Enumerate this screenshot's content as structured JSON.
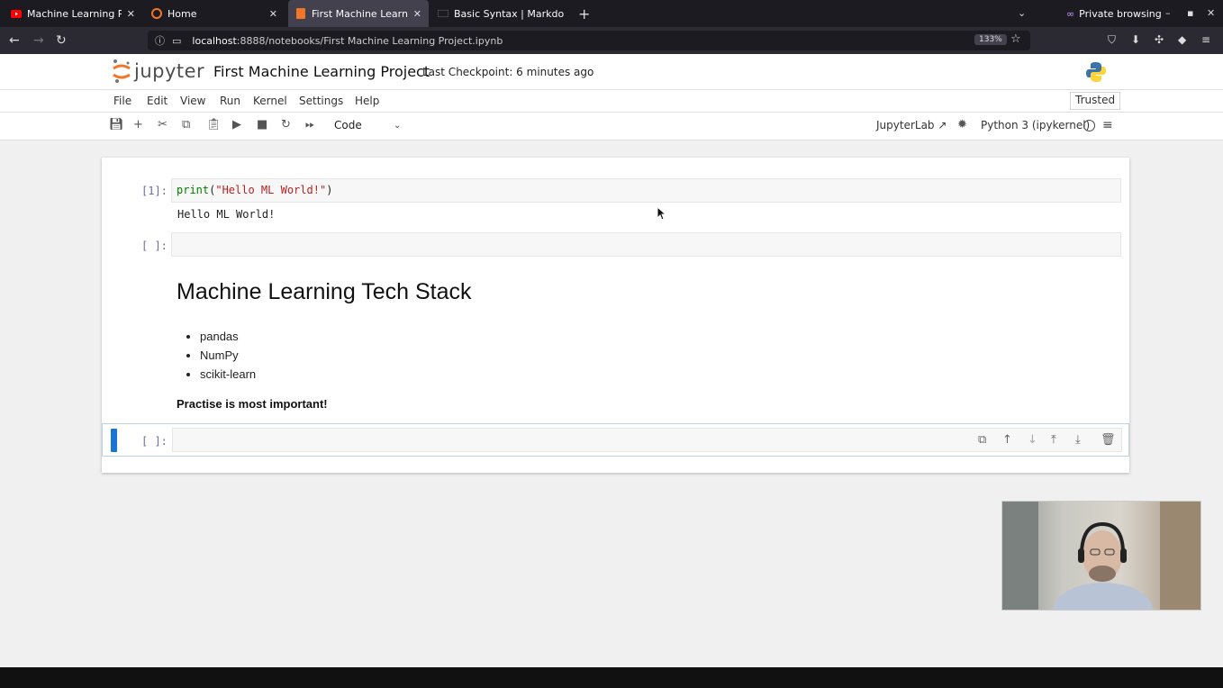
{
  "browser": {
    "tabs": [
      {
        "title": "Machine Learning Project",
        "icon": "youtube-icon",
        "active": false
      },
      {
        "title": "Home",
        "icon": "jupyter-icon",
        "active": false
      },
      {
        "title": "First Machine Learning Pr",
        "icon": "jupyter-notebook-icon",
        "active": true
      },
      {
        "title": "Basic Syntax | Markdown G",
        "icon": "markdown-icon",
        "active": false
      }
    ],
    "private_label": "Private browsing",
    "url_host": "localhost",
    "url_rest": ":8888/notebooks/First Machine Learning Project.ipynb",
    "zoom": "133%"
  },
  "jupyter": {
    "logo_text": "jupyter",
    "notebook_title": "First Machine Learning Project",
    "checkpoint": "Last Checkpoint: 6 minutes ago",
    "menu": [
      "File",
      "Edit",
      "View",
      "Run",
      "Kernel",
      "Settings",
      "Help"
    ],
    "trusted": "Trusted",
    "cell_type": "Code",
    "jupyterlab_link": "JupyterLab",
    "kernel_name": "Python 3 (ipykernel)"
  },
  "cells": {
    "cell1": {
      "prompt": "[1]:",
      "code_fn": "print",
      "code_open": "(",
      "code_str": "\"Hello ML World!\"",
      "code_close": ")",
      "output": "Hello ML World!"
    },
    "cell2": {
      "prompt": "[ ]:"
    },
    "markdown": {
      "heading": "Machine Learning Tech Stack",
      "items": [
        "pandas",
        "NumPy",
        "scikit-learn"
      ],
      "bold": "Practise is most important!"
    },
    "cell3": {
      "prompt": "[ ]:"
    }
  }
}
